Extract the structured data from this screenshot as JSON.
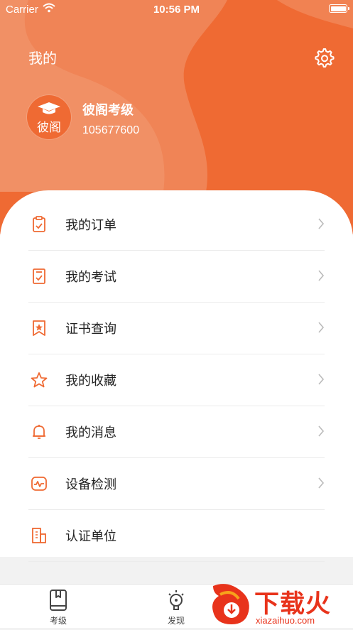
{
  "status_bar": {
    "carrier": "Carrier",
    "time": "10:56 PM"
  },
  "header": {
    "title": "我的",
    "settings_icon": "gear-icon"
  },
  "profile": {
    "avatar_text": "彼阁",
    "name": "彼阁考级",
    "id": "105677600"
  },
  "menu": [
    {
      "label": "我的订单",
      "icon": "clipboard-icon",
      "chevron": true
    },
    {
      "label": "我的考试",
      "icon": "exam-sheet-icon",
      "chevron": true
    },
    {
      "label": "证书查询",
      "icon": "bookmark-star-icon",
      "chevron": true
    },
    {
      "label": "我的收藏",
      "icon": "star-icon",
      "chevron": true
    },
    {
      "label": "我的消息",
      "icon": "bell-icon",
      "chevron": true
    },
    {
      "label": "设备检测",
      "icon": "monitor-pulse-icon",
      "chevron": true
    },
    {
      "label": "认证单位",
      "icon": "building-icon",
      "chevron": false
    }
  ],
  "tabbar": [
    {
      "label": "考级",
      "icon": "book-icon"
    },
    {
      "label": "发现",
      "icon": "lightbulb-icon"
    }
  ],
  "watermark": {
    "text": "下载火",
    "url": "xiazaihuo.com"
  },
  "colors": {
    "accent": "#ef6a33",
    "hero_light": "#f08b5e",
    "watermark": "#e8331b"
  }
}
